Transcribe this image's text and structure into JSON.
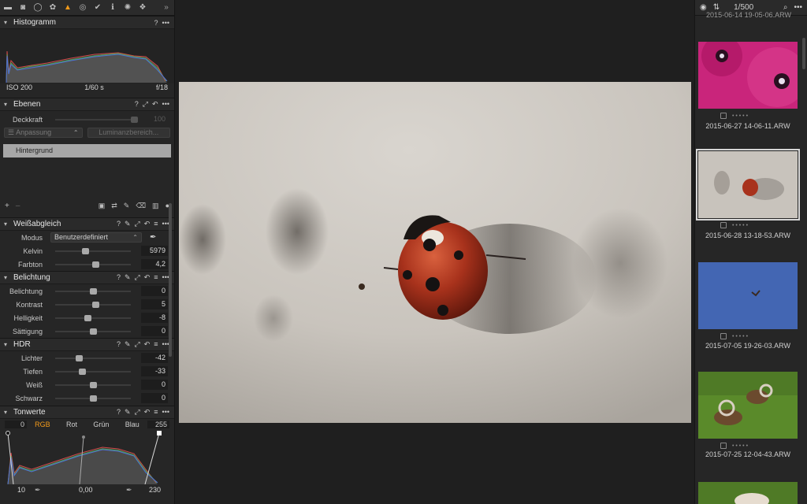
{
  "histogram": {
    "title": "Histogramm",
    "iso": "ISO 200",
    "shutter": "1/60 s",
    "aperture": "f/18"
  },
  "layers": {
    "title": "Ebenen",
    "opacity_label": "Deckkraft",
    "opacity_value": "100",
    "adjust_dropdown": "Anpassung",
    "luminance_button": "Luminanzbereich...",
    "layer_name": "Hintergrund"
  },
  "white_balance": {
    "title": "Weißabgleich",
    "mode_label": "Modus",
    "mode_value": "Benutzerdefiniert",
    "rows": [
      {
        "label": "Kelvin",
        "value": "5979",
        "level": 0.4
      },
      {
        "label": "Farbton",
        "value": "4,2",
        "level": 0.53
      }
    ]
  },
  "exposure": {
    "title": "Belichtung",
    "rows": [
      {
        "label": "Belichtung",
        "value": "0",
        "level": 0.5
      },
      {
        "label": "Kontrast",
        "value": "5",
        "level": 0.53
      },
      {
        "label": "Helligkeit",
        "value": "-8",
        "level": 0.43
      },
      {
        "label": "Sättigung",
        "value": "0",
        "level": 0.5
      }
    ]
  },
  "hdr": {
    "title": "HDR",
    "rows": [
      {
        "label": "Lichter",
        "value": "-42",
        "level": 0.31
      },
      {
        "label": "Tiefen",
        "value": "-33",
        "level": 0.35
      },
      {
        "label": "Weiß",
        "value": "0",
        "level": 0.5
      },
      {
        "label": "Schwarz",
        "value": "0",
        "level": 0.5
      }
    ]
  },
  "curve": {
    "title": "Tonwerte",
    "input_min": "0",
    "input_max": "255",
    "channels": [
      "RGB",
      "Rot",
      "Grün",
      "Blau"
    ],
    "active_channel": "RGB",
    "output_low": "10",
    "midpoint": "0,00",
    "output_high": "230"
  },
  "browser": {
    "counter": "1/500",
    "top_partial_name": "2015-06-14 19-05-06.ARW",
    "items": [
      {
        "name": "2015-06-27 14-06-11.ARW"
      },
      {
        "name": "2015-06-28 13-18-53.ARW",
        "selected": true
      },
      {
        "name": "2015-07-05 19-26-03.ARW"
      },
      {
        "name": "2015-07-25 12-04-43.ARW"
      }
    ]
  },
  "colors": {
    "accent": "#f29a1a",
    "panel_bg": "#262626",
    "viewer_bg": "#1f1f1f"
  }
}
